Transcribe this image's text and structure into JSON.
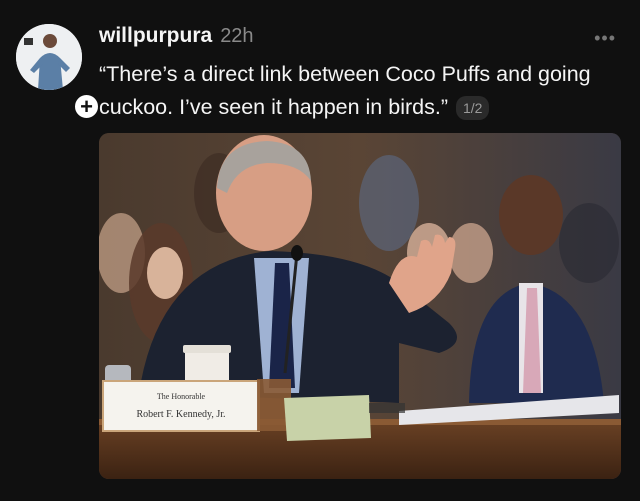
{
  "post": {
    "username": "willpurpura",
    "timestamp": "22h",
    "text": "“There’s a direct link between Coco Puffs and going cuckoo. I’ve seen it happen in birds.”",
    "page_indicator": "1/2",
    "follow_symbol": "+",
    "more_symbol": "•••"
  },
  "media": {
    "placard_line1": "The Honorable",
    "placard_line2": "Robert F. Kennedy, Jr."
  },
  "icons": {
    "follow": "plus-icon",
    "more": "ellipsis-icon"
  },
  "colors": {
    "background": "#101010",
    "text": "#f5f5f5",
    "muted": "#8a8a8a"
  }
}
